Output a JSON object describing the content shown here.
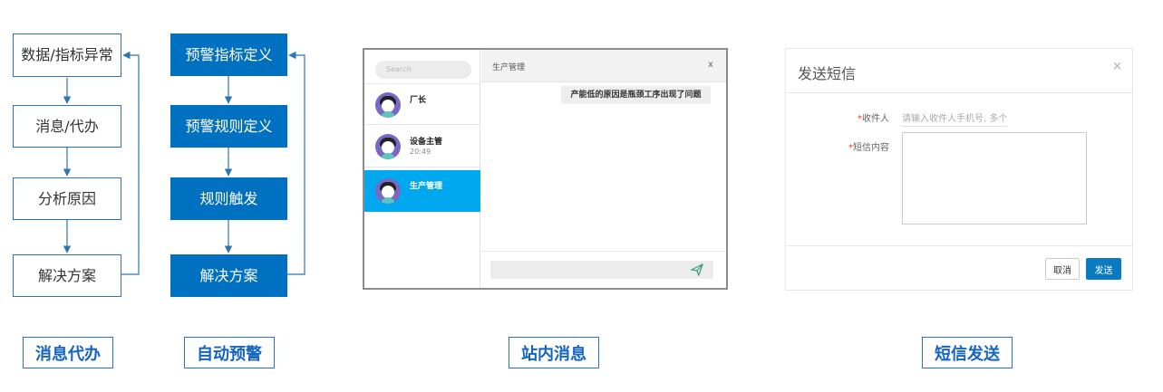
{
  "todo_flow": {
    "steps": [
      "数据/指标异常",
      "消息/代办",
      "分析原因",
      "解决方案"
    ],
    "caption": "消息代办"
  },
  "alert_flow": {
    "steps": [
      "预警指标定义",
      "预警规则定义",
      "规则触发",
      "解决方案"
    ],
    "caption": "自动预警"
  },
  "inbox": {
    "search_placeholder": "Search",
    "contacts": [
      {
        "name": "厂长",
        "time": ""
      },
      {
        "name": "设备主管",
        "time": "20:49"
      },
      {
        "name": "生产管理",
        "time": ""
      }
    ],
    "active_contact": "生产管理",
    "chat_title": "生产管理",
    "close_label": "x",
    "message": "产能低的原因是瓶颈工序出现了问题",
    "caption": "站内消息",
    "colors": {
      "active": "#00a8f0",
      "avatar": "#7a68c9"
    }
  },
  "sms": {
    "title": "发送短信",
    "close_label": "×",
    "required_mark": "*",
    "recipient_label": "收件人",
    "recipient_placeholder": "请输入收件人手机号, 多个",
    "content_label": "短信内容",
    "cancel_label": "取消",
    "send_label": "发送",
    "caption": "短信发送",
    "colors": {
      "primary": "#0a7bbf"
    }
  },
  "colors": {
    "accent": "#0070c0",
    "line": "#2e74b5"
  }
}
